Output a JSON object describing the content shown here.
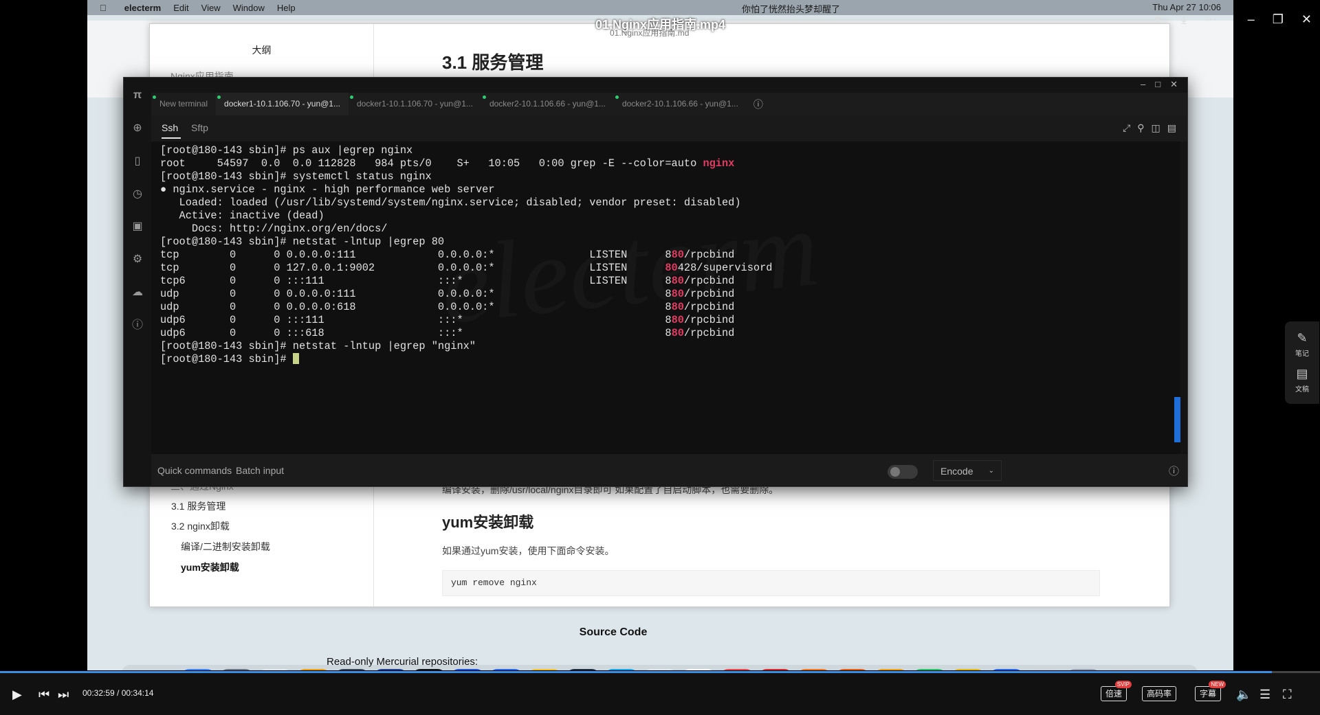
{
  "player": {
    "title": "01.Nginx应用指南.mp4",
    "subtitle": "01.Nginx应用指南.md",
    "time_current": "00:32:59",
    "time_total": "00:34:14",
    "progress": 0.9635,
    "speed_label": "倍速",
    "speed_badge": "SVIP",
    "quality_label": "高码率",
    "caption_label": "字幕",
    "caption_badge": "NEW"
  },
  "mac_menubar": {
    "app": "electerm",
    "menus": [
      "Edit",
      "View",
      "Window",
      "Help"
    ],
    "marquee": "你怕了恍然抬头梦却醒了",
    "clock": "Thu Apr 27  10:06"
  },
  "outline": {
    "title": "大纲",
    "items": [
      "Nginx应用指南",
      "三、通过Nginx",
      "3.1 服务管理",
      "3.2 nginx卸载",
      "编译/二进制安装卸载",
      "yum安装卸载"
    ]
  },
  "doc": {
    "h1": "3.1 服务管理",
    "p1": "编译安装，删除/usr/local/nginx目录即可 如果配置了自启动脚本，也需要删除。",
    "h2": "yum安装卸载",
    "p2": "如果通过yum安装，使用下面命令安装。",
    "code": "yum remove nginx",
    "source_code": "Source Code",
    "readonly": "Read-only Mercurial repositories:"
  },
  "terminal": {
    "tabs": [
      "New terminal",
      "docker1-10.1.106.70 - yun@1...",
      "docker1-10.1.106.70 - yun@1...",
      "docker2-10.1.106.66 - yun@1...",
      "docker2-10.1.106.66 - yun@1..."
    ],
    "subtabs": [
      "Ssh",
      "Sftp"
    ],
    "watermark": "electerm",
    "lines": [
      {
        "pre": "[root@180-143 sbin]# ps aux |egrep nginx",
        "hl": "",
        "post": ""
      },
      {
        "pre": "root     54597  0.0  0.0 112828   984 pts/0    S+   10:05   0:00 grep -E --color=auto ",
        "hl": "nginx",
        "post": ""
      },
      {
        "pre": "[root@180-143 sbin]# systemctl status nginx",
        "hl": "",
        "post": ""
      },
      {
        "pre": "● nginx.service - nginx - high performance web server",
        "hl": "",
        "post": ""
      },
      {
        "pre": "   Loaded: loaded (/usr/lib/systemd/system/nginx.service; disabled; vendor preset: disabled)",
        "hl": "",
        "post": ""
      },
      {
        "pre": "   Active: inactive (dead)",
        "hl": "",
        "post": ""
      },
      {
        "pre": "     Docs: http://nginx.org/en/docs/",
        "hl": "",
        "post": ""
      },
      {
        "pre": "[root@180-143 sbin]# netstat -lntup |egrep 80",
        "hl": "",
        "post": ""
      },
      {
        "pre": "tcp        0      0 0.0.0.0:111             0.0.0.0:*               LISTEN      8",
        "hl": "80",
        "post": "/rpcbind"
      },
      {
        "pre": "tcp        0      0 127.0.0.1:9002          0.0.0.0:*               LISTEN      ",
        "hl": "80",
        "post": "428/supervisord"
      },
      {
        "pre": "tcp6       0      0 :::111                  :::*                    LISTEN      8",
        "hl": "80",
        "post": "/rpcbind"
      },
      {
        "pre": "udp        0      0 0.0.0.0:111             0.0.0.0:*                           8",
        "hl": "80",
        "post": "/rpcbind"
      },
      {
        "pre": "udp        0      0 0.0.0.0:618             0.0.0.0:*                           8",
        "hl": "80",
        "post": "/rpcbind"
      },
      {
        "pre": "udp6       0      0 :::111                  :::*                                8",
        "hl": "80",
        "post": "/rpcbind"
      },
      {
        "pre": "udp6       0      0 :::618                  :::*                                8",
        "hl": "80",
        "post": "/rpcbind"
      },
      {
        "pre": "[root@180-143 sbin]# netstat -lntup |egrep \"nginx\"",
        "hl": "",
        "post": ""
      },
      {
        "pre": "[root@180-143 sbin]# ",
        "hl": "",
        "post": "",
        "cursor": true
      }
    ],
    "footer": {
      "quick_commands": "Quick commands",
      "batch_input": "Batch input",
      "encode": "Encode"
    }
  },
  "side_panel": {
    "notes": "笔记",
    "doc": "文稿"
  },
  "colors": {
    "highlight": "#e23c63",
    "progress": "#3a8ee6",
    "terminal_bg": "#101010"
  }
}
